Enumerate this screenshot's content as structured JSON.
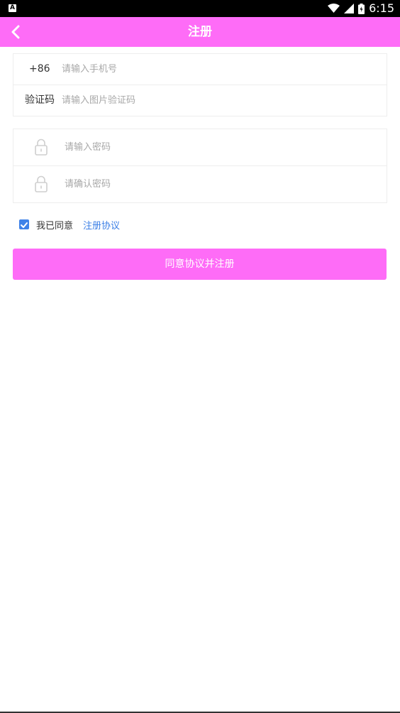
{
  "status_bar": {
    "time": "6:15",
    "app_icon_letter": "A"
  },
  "header": {
    "title": "注册"
  },
  "phone_section": {
    "country_code": "+86",
    "phone_placeholder": "请输入手机号",
    "captcha_label": "验证码",
    "captcha_placeholder": "请输入图片验证码"
  },
  "password_section": {
    "password_placeholder": "请输入密码",
    "confirm_placeholder": "请确认密码"
  },
  "agreement": {
    "checked": true,
    "text": "我已同意",
    "link": "注册协议"
  },
  "submit_label": "同意协议并注册",
  "colors": {
    "brand": "#fe6cf7",
    "link": "#3b7fe6",
    "checkbox": "#3f82e8"
  },
  "icons": [
    "back-arrow-icon",
    "lock-icon",
    "checkmark-icon",
    "wifi-icon",
    "signal-icon",
    "battery-icon"
  ]
}
